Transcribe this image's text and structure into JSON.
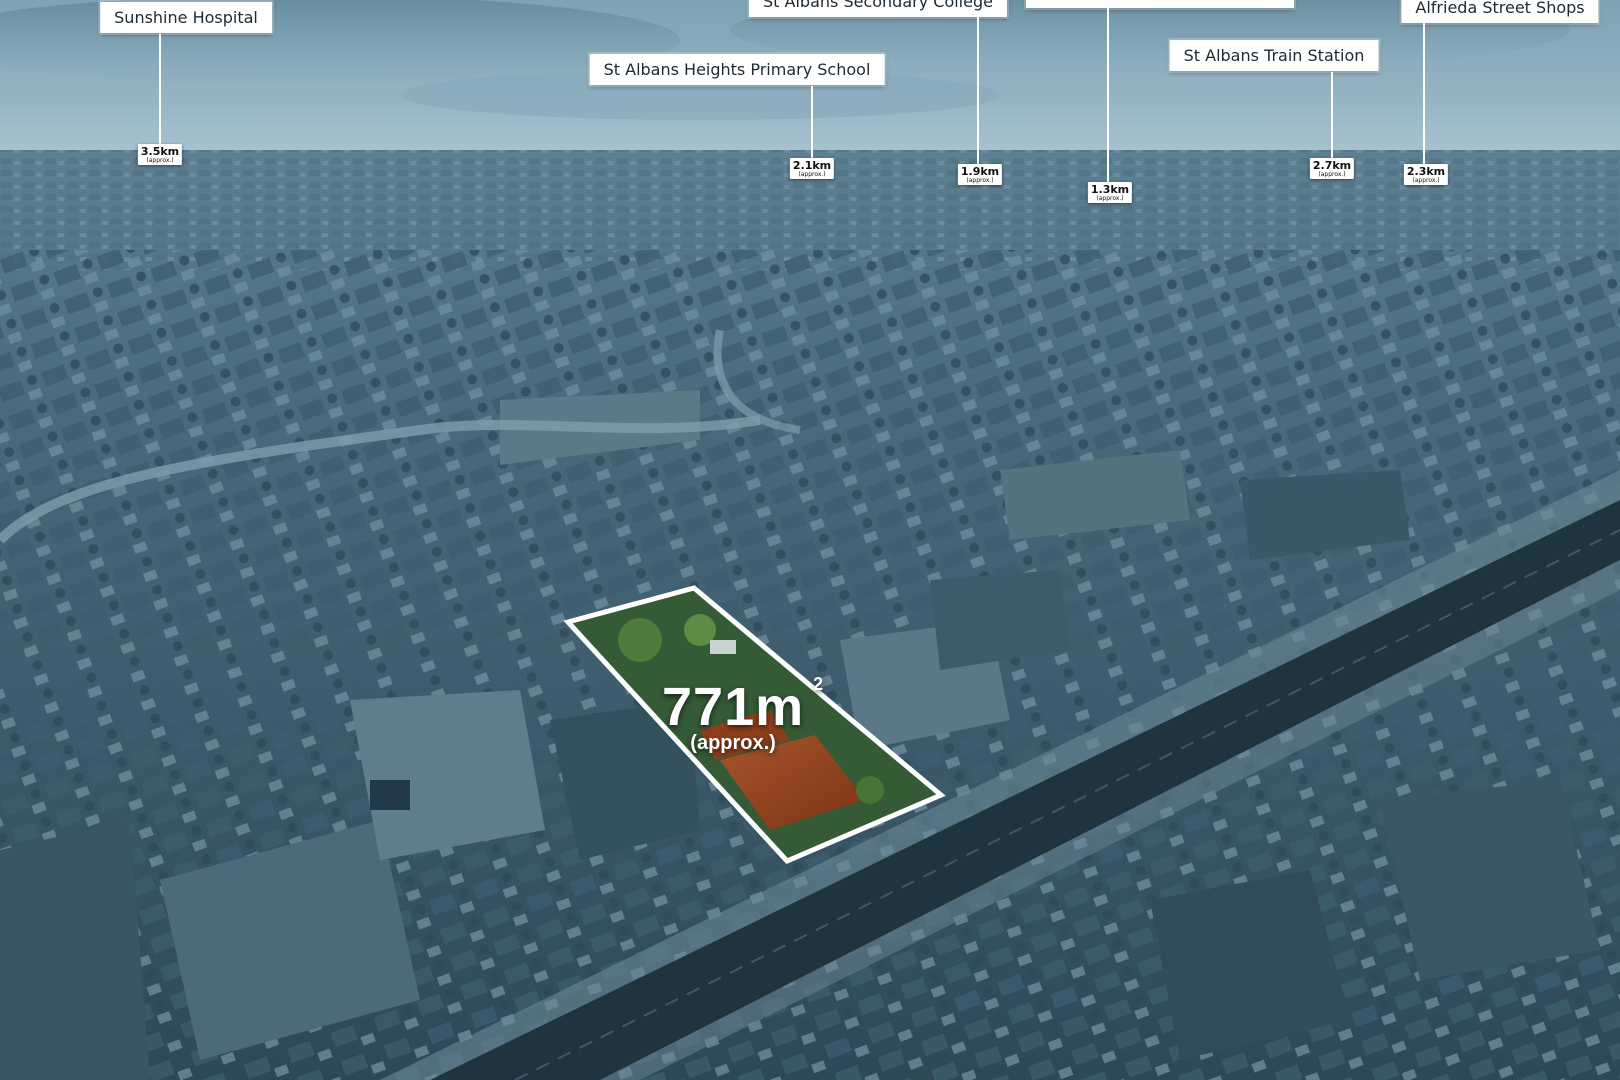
{
  "photo": {
    "description_tint": "#3f6479",
    "sky_colors": [
      "#6f97ab",
      "#9cbdcc"
    ],
    "lot_outline_color": "#ffffff"
  },
  "points_of_interest": [
    {
      "name": "Sunshine Hospital",
      "distance": "3.5km",
      "approx": "(approx.)"
    },
    {
      "name": "St Albans Secondary College",
      "distance": "1.9km",
      "approx": "(approx.)"
    },
    {
      "name": "",
      "distance": "1.3km",
      "approx": "(approx.)"
    },
    {
      "name": "Alfrieda Street Shops",
      "distance": "2.3km",
      "approx": "(approx.)"
    },
    {
      "name": "St Albans Heights Primary School",
      "distance": "2.1km",
      "approx": "(approx.)"
    },
    {
      "name": "St Albans Train Station",
      "distance": "2.7km",
      "approx": "(approx.)"
    }
  ],
  "property": {
    "area_value": "771m",
    "area_unit_sup": "2",
    "area_note": "(approx.)"
  }
}
